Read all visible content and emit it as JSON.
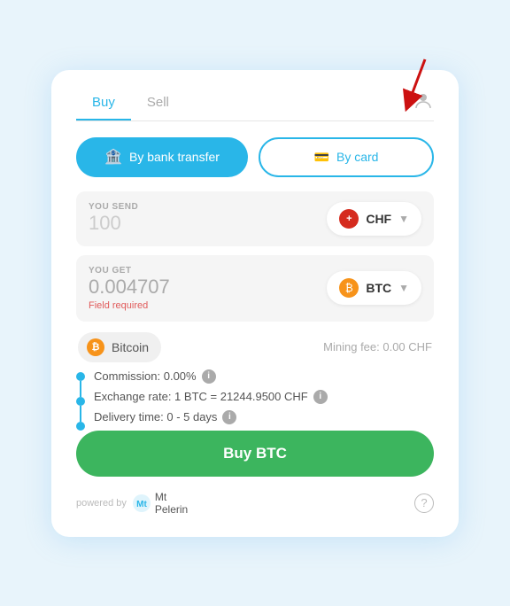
{
  "tabs": [
    {
      "id": "buy",
      "label": "Buy",
      "active": true
    },
    {
      "id": "sell",
      "label": "Sell",
      "active": false
    }
  ],
  "payment_methods": {
    "bank": {
      "label": "By bank transfer",
      "icon": "🏦"
    },
    "card": {
      "label": "By card",
      "icon": "💳"
    }
  },
  "you_send": {
    "label": "YOU SEND",
    "value": "100",
    "currency": {
      "code": "CHF",
      "symbol": "+"
    }
  },
  "you_get": {
    "label": "YOU GET",
    "value": "0.004707",
    "currency": {
      "code": "BTC",
      "symbol": "₿"
    },
    "error": "Field required"
  },
  "bitcoin_row": {
    "name": "Bitcoin",
    "mining_fee": "Mining fee: 0.00 CHF"
  },
  "info_rows": [
    {
      "text": "Commission: 0.00%",
      "has_info": true
    },
    {
      "text": "Exchange rate: 1 BTC = 21244.9500 CHF",
      "has_info": true
    },
    {
      "text": "Delivery time: 0 - 5 days",
      "has_info": true
    }
  ],
  "buy_button": {
    "label": "Buy BTC"
  },
  "footer": {
    "powered_by": "powered by",
    "brand": "Mt\nPelerin"
  },
  "colors": {
    "primary": "#29b6e8",
    "green": "#3cb55e",
    "orange": "#f7931a",
    "red": "#e05a5a"
  }
}
